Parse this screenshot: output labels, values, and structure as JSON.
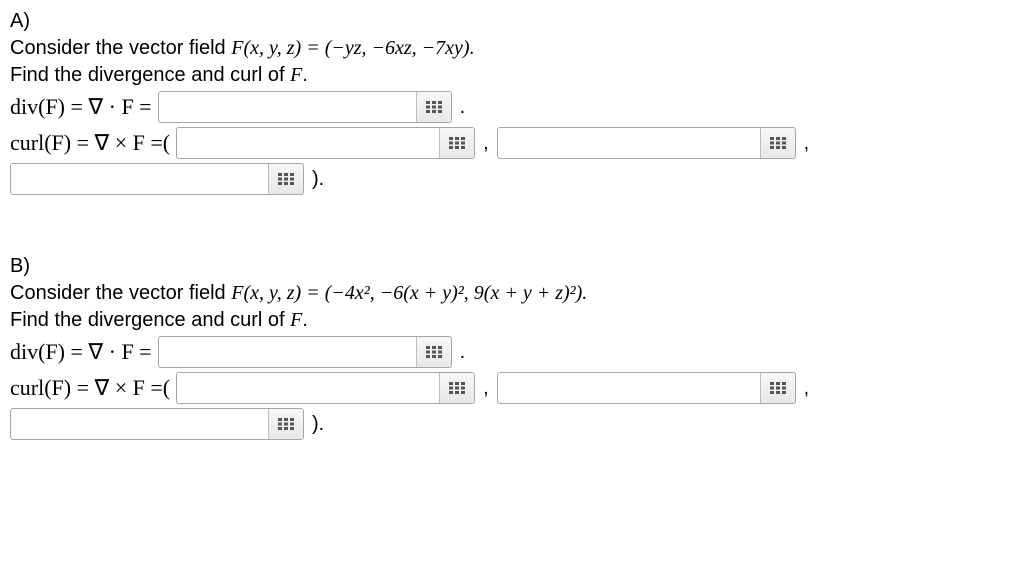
{
  "partA": {
    "label": "A)",
    "consider": "Consider the vector field ",
    "vector_field": "F(x, y, z) = (−yz, −6xz, −7xy).",
    "instruction": "Find the divergence and curl of ",
    "F": "F",
    "div_label": "div(F) = ∇ · F =",
    "curl_label": "curl(F) = ∇ × F =(",
    "closing": ").",
    "period": ".",
    "comma": ","
  },
  "partB": {
    "label": "B)",
    "consider": "Consider the vector field ",
    "vector_field": "F(x, y, z) = (−4x², −6(x + y)², 9(x + y + z)²).",
    "instruction": "Find the divergence and curl of ",
    "F": "F",
    "div_label": "div(F) = ∇ · F =",
    "curl_label": "curl(F) = ∇ × F =(",
    "closing": ").",
    "period": ".",
    "comma": ","
  }
}
